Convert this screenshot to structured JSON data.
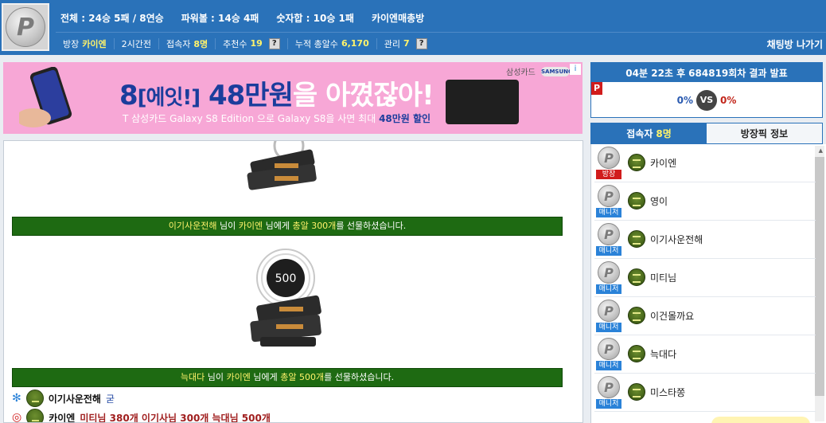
{
  "header": {
    "avatar_letter": "P",
    "stats": [
      {
        "label": "전체 :",
        "value": "24승 5패 / 8연승"
      },
      {
        "label": "파워볼 :",
        "value": "14승 4패"
      },
      {
        "label": "숫자합 :",
        "value": "10승 1패"
      },
      {
        "label": "",
        "value": "카이엔매총방"
      }
    ],
    "info": {
      "host_label": "방장",
      "host_value": "카이엔",
      "time": "2시간전",
      "users_label": "접속자",
      "users_value": "8명",
      "recommend_label": "추천수",
      "recommend_value": "19",
      "bullets_label": "누적 총알수",
      "bullets_value": "6,170",
      "manage_label": "관리",
      "manage_value": "7",
      "help_mark": "?"
    },
    "exit_label": "채팅방 나가기"
  },
  "ad": {
    "headline_num": "8",
    "headline_bracket": "[에잇!]",
    "headline_main": "48만원",
    "headline_rest": "을 아꼈잖아!",
    "sub_prefix": "T 삼성카드",
    "sub_middle": "Galaxy S8 Edition 으로 Galaxy S8을 사면 최대",
    "sub_highlight": "48만원 할인",
    "brand": "삼성카드",
    "samsung": "SAMSUNG",
    "info_mark": "i"
  },
  "chat": {
    "gift1": {
      "sender": "이기사운전해",
      "t1": "님이",
      "receiver": "카이엔",
      "t2": "님에게",
      "item": "총알 300개",
      "t3": "를 선물하셨습니다."
    },
    "gift2": {
      "count": "500",
      "sender": "늑대다",
      "t1": "님이",
      "receiver": "카이엔",
      "t2": "님에게",
      "item": "총알 500개",
      "t3": "를 선물하셨습니다."
    },
    "line1": {
      "name": "이기사운전해",
      "msg": "굳"
    },
    "line2": {
      "name": "카이엔",
      "msg": "미티님 380개 이기사님 300개 늑대님 500개"
    }
  },
  "result": {
    "head_prefix": "04분 22초 후",
    "round": "684819회차",
    "head_suffix": "결과 발표",
    "p_mark": "P",
    "left_pct": "0%",
    "vs": "VS",
    "right_pct": "0%"
  },
  "tabs": {
    "users_label": "접속자",
    "users_value": "8명",
    "info_label": "방장픽 정보"
  },
  "users": [
    {
      "name": "카이엔",
      "badge": "방장",
      "role": "host"
    },
    {
      "name": "영이",
      "badge": "매니저",
      "role": "mgr"
    },
    {
      "name": "이기사운전해",
      "badge": "매니저",
      "role": "mgr"
    },
    {
      "name": "미티님",
      "badge": "매니저",
      "role": "mgr"
    },
    {
      "name": "이건몰까요",
      "badge": "매니저",
      "role": "mgr"
    },
    {
      "name": "늑대다",
      "badge": "매니저",
      "role": "mgr"
    },
    {
      "name": "미스타쫑",
      "badge": "매니저",
      "role": "mgr"
    }
  ],
  "colors": {
    "header_bg": "#2a72b9",
    "highlight": "#fff36b",
    "gift_bar": "#1e6a12",
    "host_badge": "#d11c1c",
    "mgr_badge": "#2a82d8"
  }
}
